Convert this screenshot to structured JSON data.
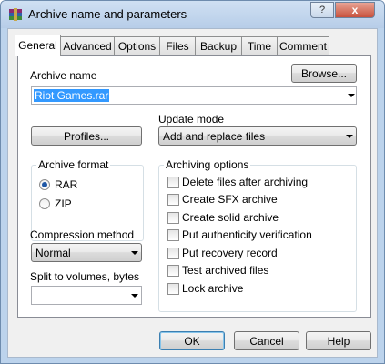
{
  "window": {
    "title": "Archive name and parameters",
    "help_glyph": "?",
    "close_glyph": "x"
  },
  "tabs": [
    "General",
    "Advanced",
    "Options",
    "Files",
    "Backup",
    "Time",
    "Comment"
  ],
  "archive_name": {
    "label": "Archive name",
    "browse_label": "Browse...",
    "value": "Riot Games.rar"
  },
  "profiles_label": "Profiles...",
  "update_mode": {
    "label": "Update mode",
    "value": "Add and replace files"
  },
  "archive_format": {
    "title": "Archive format",
    "options": [
      "RAR",
      "ZIP"
    ],
    "selected": "RAR"
  },
  "compression": {
    "label": "Compression method",
    "value": "Normal"
  },
  "split": {
    "label": "Split to volumes, bytes",
    "value": ""
  },
  "archiving_options": {
    "title": "Archiving options",
    "items": [
      {
        "label": "Delete files after archiving",
        "checked": false
      },
      {
        "label": "Create SFX archive",
        "checked": false
      },
      {
        "label": "Create solid archive",
        "checked": false
      },
      {
        "label": "Put authenticity verification",
        "checked": false
      },
      {
        "label": "Put recovery record",
        "checked": false
      },
      {
        "label": "Test archived files",
        "checked": false
      },
      {
        "label": "Lock archive",
        "checked": false
      }
    ]
  },
  "buttons": {
    "ok": "OK",
    "cancel": "Cancel",
    "help": "Help"
  },
  "colors": {
    "selection": "#3399ff",
    "title_bar": "#bcd3ec",
    "dialog_bg": "#f0f0f0"
  }
}
